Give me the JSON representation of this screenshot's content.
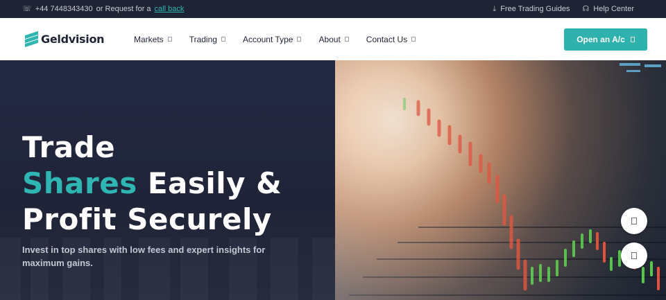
{
  "topbar": {
    "phone_icon": "phone-icon",
    "phone": "+44 7448343430",
    "or_text": "or Request for a",
    "callback_link": "call back",
    "guides_icon": "download-icon",
    "guides": "Free Trading Guides",
    "help_icon": "headset-icon",
    "help": "Help Center"
  },
  "brand": {
    "name": "Geldvision",
    "accent": "#2fb6b2"
  },
  "nav": {
    "items": [
      {
        "label": "Markets"
      },
      {
        "label": "Trading"
      },
      {
        "label": "Account Type"
      },
      {
        "label": "About"
      },
      {
        "label": "Contact Us"
      }
    ],
    "cta": "Open an A/c"
  },
  "hero": {
    "line1": "Trade",
    "line2_accent": "Shares",
    "line2_rest": " Easily &",
    "line3": "Profit Securely",
    "subtext": "Invest in top shares with low fees and expert insights for maximum gains."
  },
  "colors": {
    "dark_bg": "#1f2435",
    "teal": "#2fb1ad",
    "white": "#ffffff"
  }
}
